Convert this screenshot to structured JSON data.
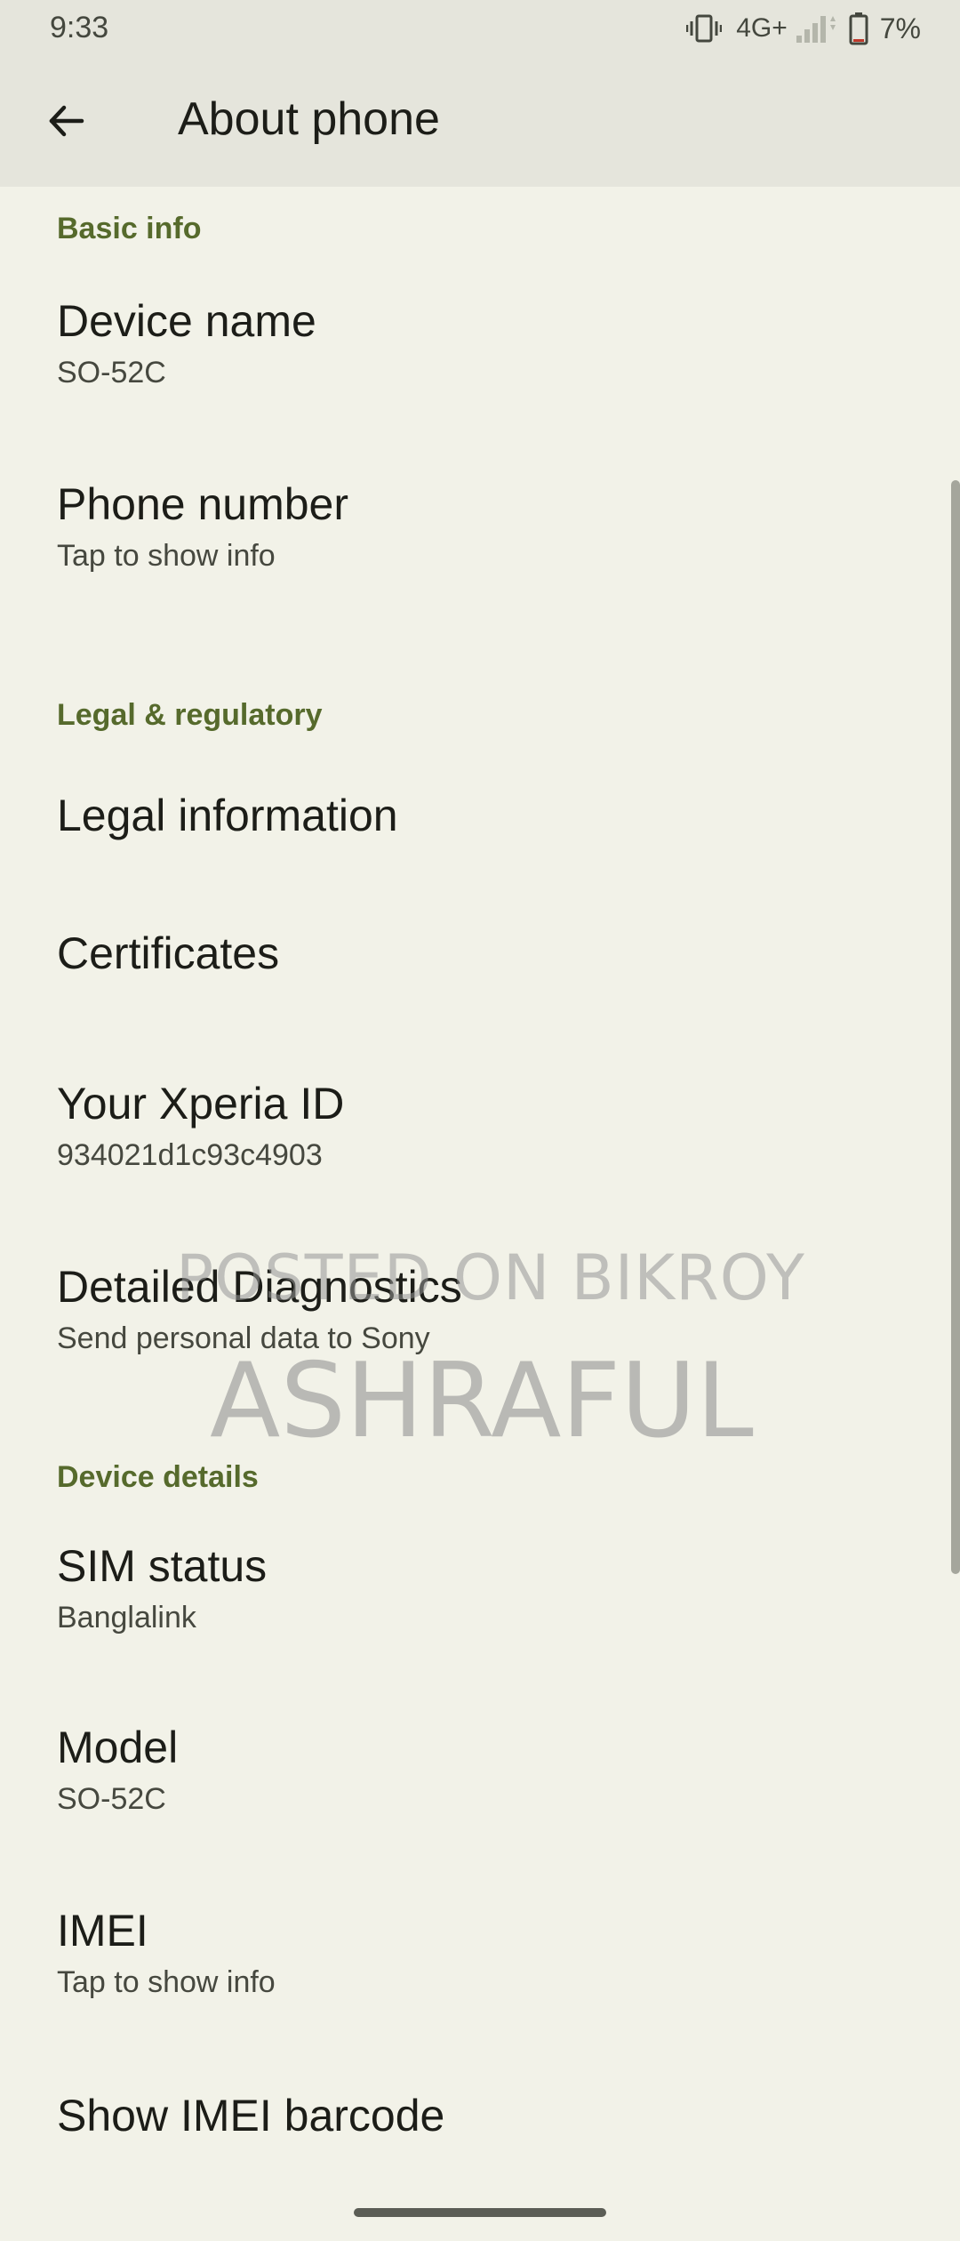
{
  "status_bar": {
    "time": "9:33",
    "network": "4G+",
    "battery": "7%",
    "icons": [
      "vibrate-icon",
      "signal-icon",
      "battery-icon"
    ]
  },
  "app_bar": {
    "title": "About phone",
    "back_icon": "arrow-back-icon"
  },
  "sections": {
    "basic_info": "Basic info",
    "legal": "Legal & regulatory",
    "device_details": "Device details"
  },
  "items": {
    "device_name": {
      "title": "Device name",
      "summary": "SO-52C"
    },
    "phone_number": {
      "title": "Phone number",
      "summary": "Tap to show info"
    },
    "legal_information": {
      "title": "Legal information"
    },
    "certificates": {
      "title": "Certificates"
    },
    "xperia_id": {
      "title": "Your Xperia ID",
      "summary": "934021d1c93c4903"
    },
    "diagnostics": {
      "title": "Detailed Diagnostics",
      "summary": "Send personal data to Sony"
    },
    "sim_status": {
      "title": "SIM status",
      "summary": "Banglalink"
    },
    "model": {
      "title": "Model",
      "summary": "SO-52C"
    },
    "imei": {
      "title": "IMEI",
      "summary": "Tap to show info"
    },
    "imei_barcode": {
      "title": "Show IMEI barcode"
    }
  },
  "watermark": {
    "line1": "POSTED ON BIKROY",
    "line2": "ASHRAFUL"
  },
  "colors": {
    "background": "#f2f2e8",
    "app_bar": "#e5e5dc",
    "section_header": "#566a2c",
    "title_text": "#1c1d18",
    "summary_text": "#46483f"
  }
}
